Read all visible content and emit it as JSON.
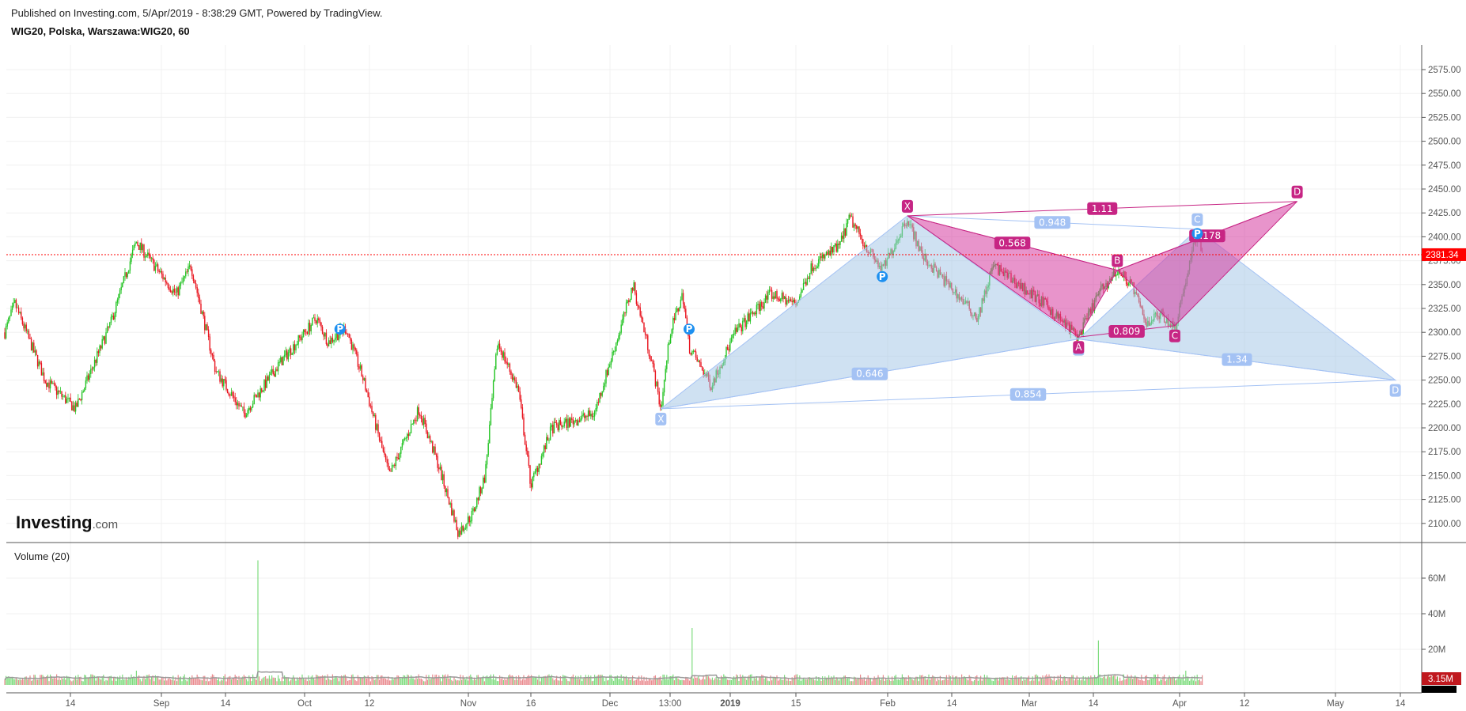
{
  "header": {
    "published": "Published on Investing.com, 5/Apr/2019 - 8:38:29 GMT, Powered by TradingView.",
    "symbol": "WIG20, Polska, Warszawa:WIG20, 60"
  },
  "logo": {
    "main": "Investing",
    "suffix": ".com"
  },
  "volume_label": "Volume (20)",
  "colors": {
    "up": "#22c322",
    "down": "#e8141e",
    "blue_pattern": "#a4c2f4",
    "pink_pattern": "#c72584",
    "last_price": "#ff0000",
    "vol_last": "#c0181e"
  },
  "chart_data": {
    "type": "candlestick",
    "title": "WIG20, Polska, Warszawa:WIG20, 60",
    "price_axis": {
      "ticks": [
        "2575.00",
        "2550.00",
        "2525.00",
        "2500.00",
        "2475.00",
        "2450.00",
        "2425.00",
        "2400.00",
        "2375.00",
        "2350.00",
        "2325.00",
        "2300.00",
        "2275.00",
        "2250.00",
        "2225.00",
        "2200.00",
        "2175.00",
        "2150.00",
        "2125.00",
        "2100.00"
      ],
      "range": [
        2085,
        2590
      ]
    },
    "volume_axis": {
      "ticks": [
        "60M",
        "40M",
        "20M"
      ],
      "range_millions": [
        0,
        75
      ]
    },
    "x_ticks": [
      "14",
      "Sep",
      "14",
      "Oct",
      "12",
      "Nov",
      "16",
      "Dec",
      "13:00",
      "2019",
      "15",
      "Feb",
      "14",
      "Mar",
      "14",
      "Apr",
      "12",
      "May",
      "14"
    ],
    "last_price": "2381.34",
    "last_volume": "3.15M",
    "price_path": [
      [
        "2018-08-01",
        2300
      ],
      [
        "2018-08-03",
        2330
      ],
      [
        "2018-08-09",
        2250
      ],
      [
        "2018-08-15",
        2220
      ],
      [
        "2018-08-22",
        2310
      ],
      [
        "2018-08-27",
        2395
      ],
      [
        "2018-09-04",
        2340
      ],
      [
        "2018-09-07",
        2370
      ],
      [
        "2018-09-12",
        2260
      ],
      [
        "2018-09-18",
        2215
      ],
      [
        "2018-09-26",
        2270
      ],
      [
        "2018-10-03",
        2315
      ],
      [
        "2018-10-05",
        2290
      ],
      [
        "2018-10-08",
        2305
      ],
      [
        "2018-10-11",
        2250
      ],
      [
        "2018-10-16",
        2150
      ],
      [
        "2018-10-22",
        2220
      ],
      [
        "2018-10-26",
        2160
      ],
      [
        "2018-10-30",
        2090
      ],
      [
        "2018-11-02",
        2110
      ],
      [
        "2018-11-05",
        2150
      ],
      [
        "2018-11-08",
        2290
      ],
      [
        "2018-11-13",
        2240
      ],
      [
        "2018-11-16",
        2140
      ],
      [
        "2018-11-20",
        2200
      ],
      [
        "2018-11-28",
        2215
      ],
      [
        "2018-12-03",
        2300
      ],
      [
        "2018-12-06",
        2350
      ],
      [
        "2018-12-10",
        2270
      ],
      [
        "2018-12-12",
        2220
      ],
      [
        "2018-12-14",
        2300
      ],
      [
        "2018-12-18",
        2340
      ],
      [
        "2018-12-20",
        2285
      ],
      [
        "2018-12-27",
        2245
      ],
      [
        "2019-01-03",
        2300
      ],
      [
        "2019-01-10",
        2340
      ],
      [
        "2019-01-15",
        2330
      ],
      [
        "2019-01-18",
        2370
      ],
      [
        "2019-01-23",
        2390
      ],
      [
        "2019-01-25",
        2420
      ],
      [
        "2019-01-28",
        2390
      ],
      [
        "2019-01-31",
        2365
      ],
      [
        "2019-02-05",
        2420
      ],
      [
        "2019-02-08",
        2380
      ],
      [
        "2019-02-15",
        2340
      ],
      [
        "2019-02-19",
        2315
      ],
      [
        "2019-02-22",
        2370
      ],
      [
        "2019-02-27",
        2350
      ],
      [
        "2019-03-04",
        2330
      ],
      [
        "2019-03-08",
        2310
      ],
      [
        "2019-03-11",
        2295
      ],
      [
        "2019-03-15",
        2340
      ],
      [
        "2019-03-19",
        2365
      ],
      [
        "2019-03-22",
        2350
      ],
      [
        "2019-03-25",
        2310
      ],
      [
        "2019-03-28",
        2320
      ],
      [
        "2019-03-31",
        2305
      ],
      [
        "2019-04-03",
        2380
      ],
      [
        "2019-04-04",
        2405
      ],
      [
        "2019-04-05",
        2381.34
      ]
    ],
    "volume_spikes_millions": [
      [
        "2018-09-21",
        70
      ],
      [
        "2018-12-21",
        32
      ],
      [
        "2019-03-15",
        25
      ],
      [
        "2018-08-27",
        8
      ],
      [
        "2018-09-14",
        6
      ],
      [
        "2019-04-02",
        8
      ]
    ],
    "patterns": [
      {
        "name": "blue",
        "points": [
          {
            "label": "X",
            "date": "2018-12-12",
            "price": 2220
          },
          {
            "label": "A",
            "date": "2019-02-05",
            "price": 2422
          },
          {
            "label": "B",
            "date": "2019-03-11",
            "price": 2293
          },
          {
            "label": "C",
            "date": "2019-04-04",
            "price": 2408
          },
          {
            "label": "D",
            "date": "2019-05-13",
            "price": 2250
          }
        ],
        "ratios": {
          "XB": "0.646",
          "AC": "0.948",
          "BD": "1.34",
          "XD": "0.854"
        }
      },
      {
        "name": "pink",
        "points": [
          {
            "label": "X",
            "date": "2019-02-05",
            "price": 2422
          },
          {
            "label": "A",
            "date": "2019-03-11",
            "price": 2295
          },
          {
            "label": "B",
            "date": "2019-03-19",
            "price": 2365
          },
          {
            "label": "C",
            "date": "2019-03-31",
            "price": 2307
          },
          {
            "label": "D",
            "date": "2019-04-23",
            "price": 2437
          }
        ],
        "ratios": {
          "XB": "0.568",
          "AC": "0.809",
          "BD": "2.178",
          "XD": "1.11"
        }
      }
    ],
    "pivot_markers": {
      "label": "P",
      "points": [
        [
          "2018-10-07",
          2300
        ],
        [
          "2018-12-20",
          2300
        ],
        [
          "2019-01-31",
          2355
        ],
        [
          "2019-04-04",
          2400
        ]
      ]
    }
  }
}
